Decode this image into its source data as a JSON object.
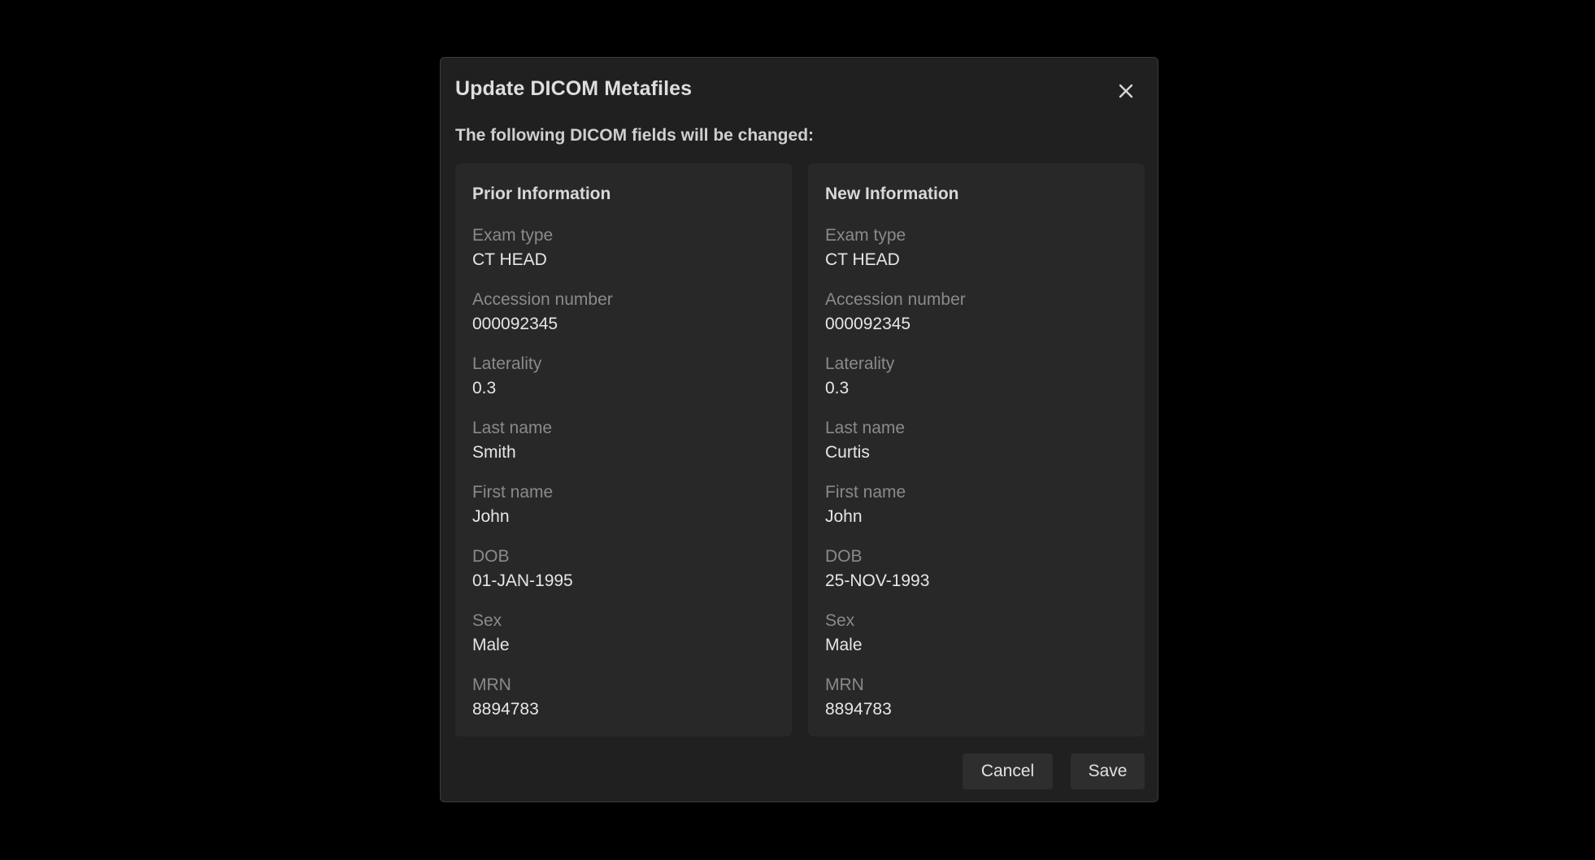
{
  "dialog": {
    "title": "Update DICOM Metafiles",
    "subtitle": "The following DICOM fields will be changed:",
    "close_icon": "close-icon",
    "cancel_label": "Cancel",
    "save_label": "Save"
  },
  "prior": {
    "heading": "Prior Information",
    "fields": [
      {
        "label": "Exam type",
        "value": "CT HEAD"
      },
      {
        "label": "Accession number",
        "value": "000092345"
      },
      {
        "label": "Laterality",
        "value": "0.3"
      },
      {
        "label": "Last name",
        "value": "Smith"
      },
      {
        "label": "First name",
        "value": "John"
      },
      {
        "label": "DOB",
        "value": "01-JAN-1995"
      },
      {
        "label": "Sex",
        "value": "Male"
      },
      {
        "label": "MRN",
        "value": "8894783"
      }
    ]
  },
  "new": {
    "heading": "New Information",
    "fields": [
      {
        "label": "Exam type",
        "value": "CT HEAD"
      },
      {
        "label": "Accession number",
        "value": "000092345"
      },
      {
        "label": "Laterality",
        "value": "0.3"
      },
      {
        "label": "Last name",
        "value": "Curtis"
      },
      {
        "label": "First name",
        "value": "John"
      },
      {
        "label": "DOB",
        "value": "25-NOV-1993"
      },
      {
        "label": "Sex",
        "value": "Male"
      },
      {
        "label": "MRN",
        "value": "8894783"
      }
    ]
  },
  "colors": {
    "background": "#000000",
    "dialog": "#202020",
    "panel": "#282828",
    "label": "#8a8a8a",
    "value": "#e6e6e6"
  }
}
